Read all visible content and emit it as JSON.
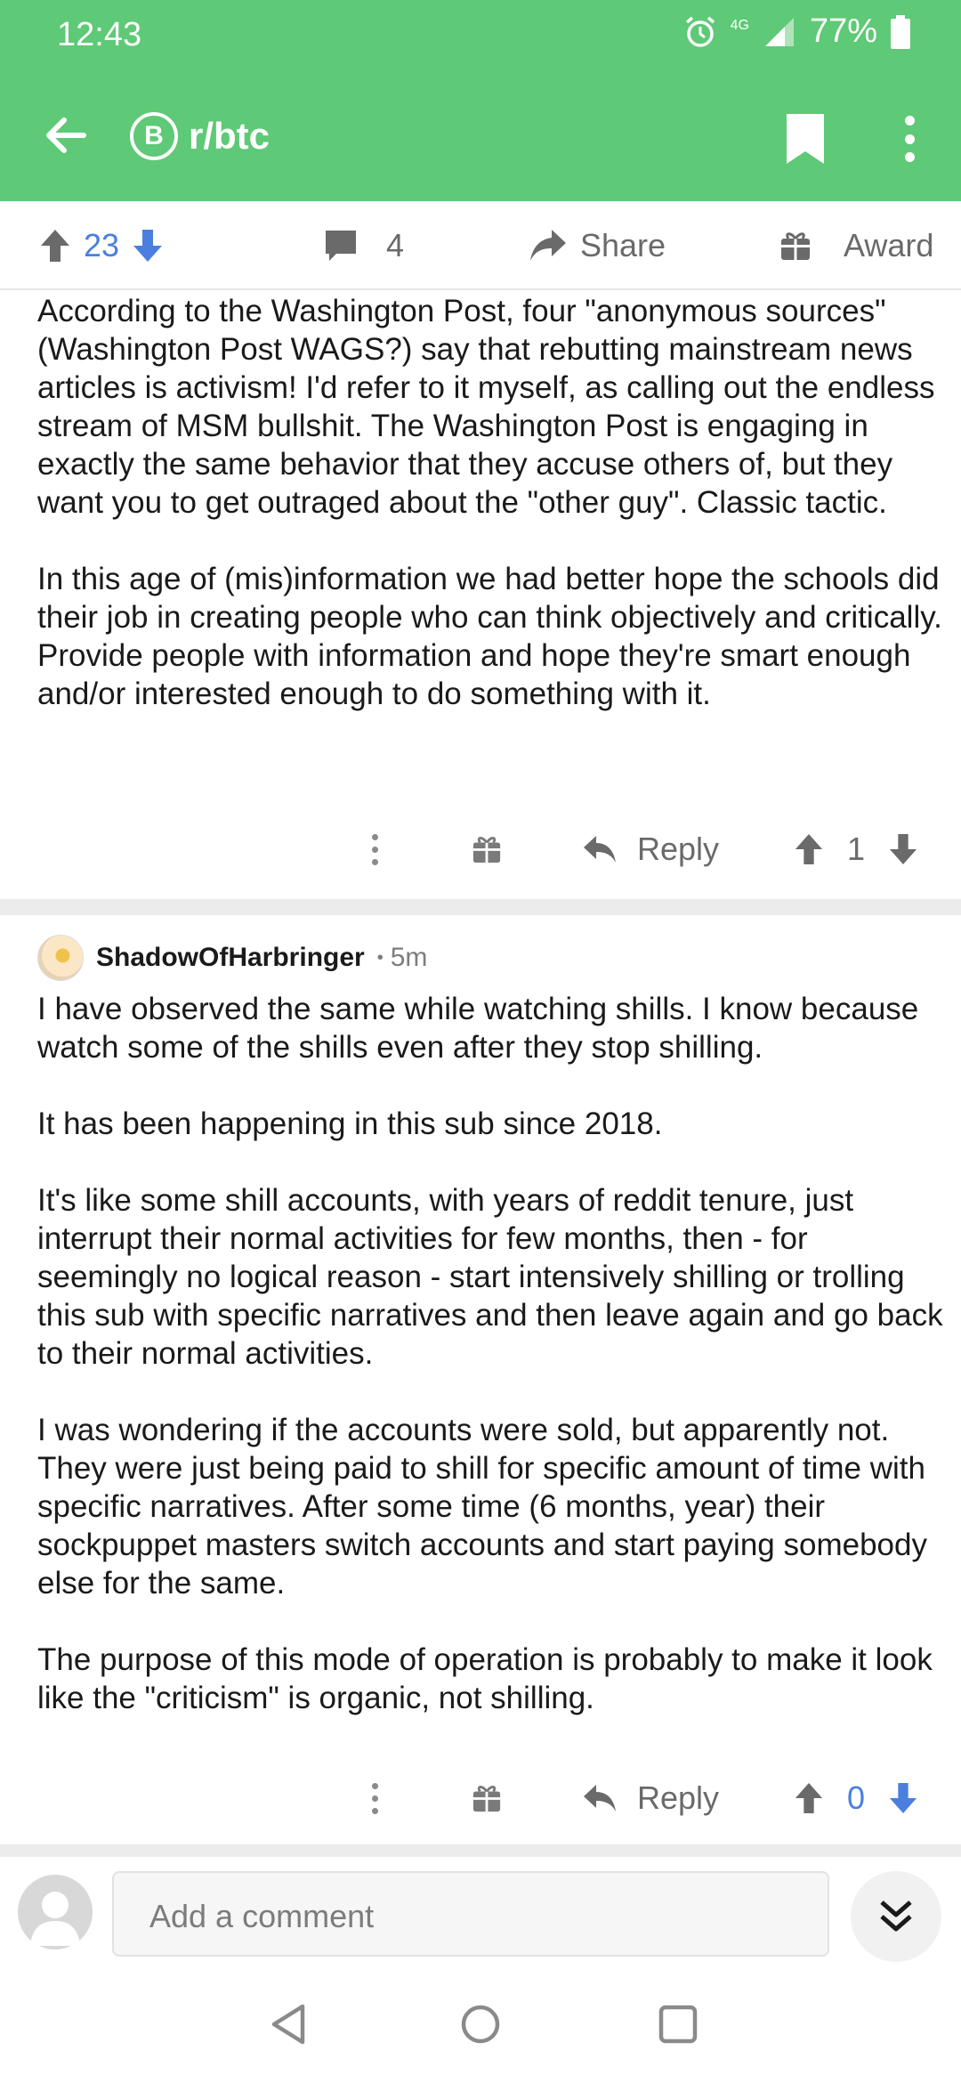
{
  "status": {
    "time": "12:43",
    "network": "4G",
    "battery": "77%"
  },
  "appbar": {
    "subreddit": "r/btc",
    "sub_icon_glyph": "B"
  },
  "post_actions": {
    "score": "23",
    "comments": "4",
    "share": "Share",
    "award": "Award"
  },
  "comment1": {
    "paragraphs": [
      "According to the Washington Post, four \"anonymous sources\" (Washington Post WAGS?) say that rebutting mainstream news articles is activism! I'd refer to it myself, as calling out the endless stream of MSM bullshit. The Washington Post is engaging in exactly the same behavior that they accuse others of, but they want you to get outraged about the \"other guy\". Classic tactic.",
      "In this age of (mis)information we had better hope the schools did their job in creating people who can think objectively and critically. Provide people with information and hope they're smart enough and/or interested enough to do something with it."
    ],
    "reply_label": "Reply",
    "score": "1"
  },
  "comment2": {
    "author": "ShadowOfHarbringer",
    "separator": "•",
    "age": "5m",
    "paragraphs": [
      "I have observed the same while watching shills. I know because watch some of the shills even after they stop shilling.",
      "It has been happening in this sub since 2018.",
      "It's like some shill accounts, with years of reddit tenure, just interrupt their normal activities for few months, then - for seemingly no logical reason - start intensively shilling or trolling this sub with specific narratives and then leave again and go back to their normal activities.",
      "I was wondering if the accounts were sold, but apparently not. They were just being paid to shill for specific amount of time with specific narratives. After some time (6 months, year) their sockpuppet masters switch accounts and start paying somebody else for the same.",
      "The purpose of this mode of operation is probably to make it look like the \"criticism\" is organic, not shilling."
    ],
    "reply_label": "Reply",
    "score": "0"
  },
  "comment_bar": {
    "placeholder": "Add a comment"
  },
  "colors": {
    "brand_green": "#5ec976",
    "upvote_blue": "#4a7fe0",
    "icon_gray": "#6a6a6a"
  },
  "icons": [
    "alarm-icon",
    "signal-icon",
    "battery-icon",
    "back-arrow-icon",
    "bitcoin-icon",
    "bookmark-icon",
    "more-vert-icon",
    "upvote-icon",
    "downvote-icon",
    "comment-icon",
    "share-icon",
    "award-icon",
    "reply-icon",
    "chevron-double-down-icon",
    "nav-back-icon",
    "nav-home-icon",
    "nav-recents-icon"
  ]
}
